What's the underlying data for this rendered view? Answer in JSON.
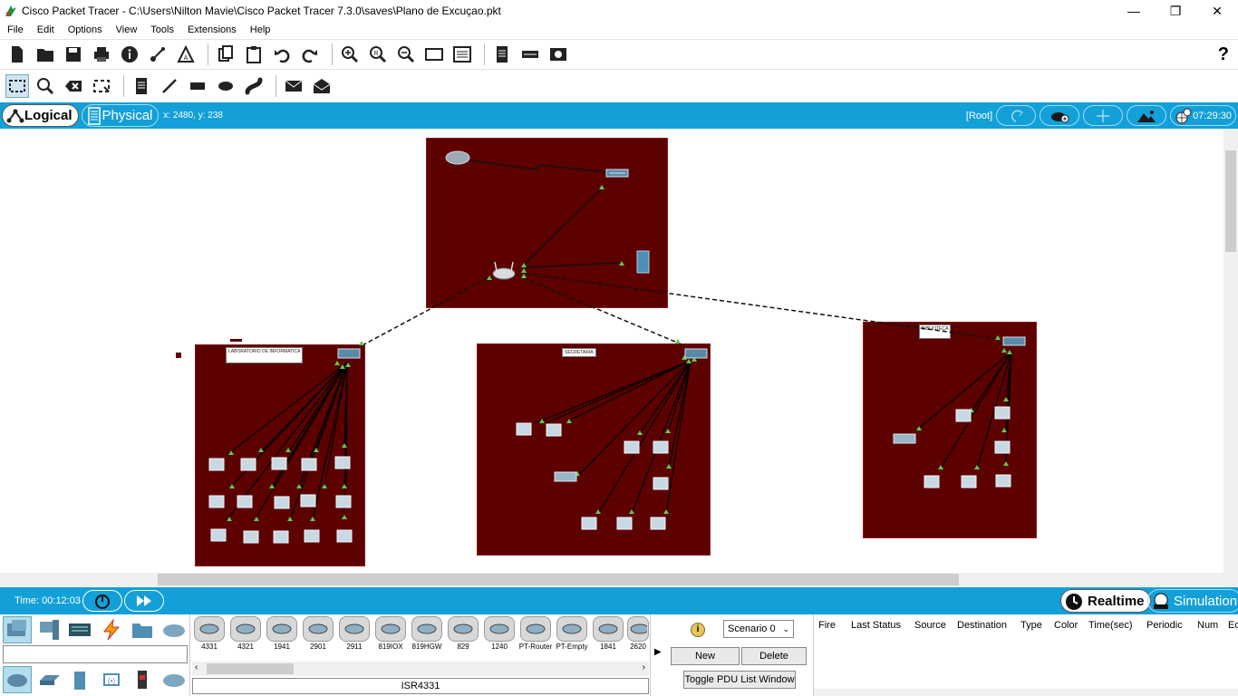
{
  "window": {
    "title": "Cisco Packet Tracer - C:\\Users\\Nilton Mavie\\Cisco Packet Tracer 7.3.0\\saves\\Plano de Excuçao.pkt",
    "minimize": "—",
    "maximize": "❐",
    "close": "✕"
  },
  "menu": [
    "File",
    "Edit",
    "Options",
    "View",
    "Tools",
    "Extensions",
    "Help"
  ],
  "toolbar": {
    "help": "?"
  },
  "modes": {
    "logical": "Logical",
    "physical": "Physical",
    "coords": "x: 2480, y: 238",
    "root": "[Root]",
    "clock": "07:29:30"
  },
  "canvas": {
    "areas": [
      {
        "name": "LABORATORIO DE INFORMATICA"
      },
      {
        "name": "SECRETARIA"
      },
      {
        "name": "BIBLIOTECA"
      }
    ]
  },
  "status": {
    "time": "Time: 00:12:03",
    "realtime": "Realtime",
    "simulation": "Simulation"
  },
  "devices": {
    "items": [
      "4331",
      "4321",
      "1941",
      "2901",
      "2911",
      "819IOX",
      "819HGW",
      "829",
      "1240",
      "PT-Router",
      "PT-Empty",
      "1841",
      "2620"
    ],
    "selected_name": "ISR4331"
  },
  "scenario": {
    "selected": "Scenario 0",
    "new": "New",
    "delete": "Delete",
    "toggle": "Toggle PDU List Window",
    "info_icon": "i"
  },
  "pdu_table": {
    "columns": [
      "Fire",
      "Last Status",
      "Source",
      "Destination",
      "Type",
      "Color",
      "Time(sec)",
      "Periodic",
      "Num",
      "Ed"
    ]
  },
  "colors": {
    "accent": "#13a0d8",
    "area_fill": "#5c0000",
    "link_up": "#5ecb4a"
  }
}
